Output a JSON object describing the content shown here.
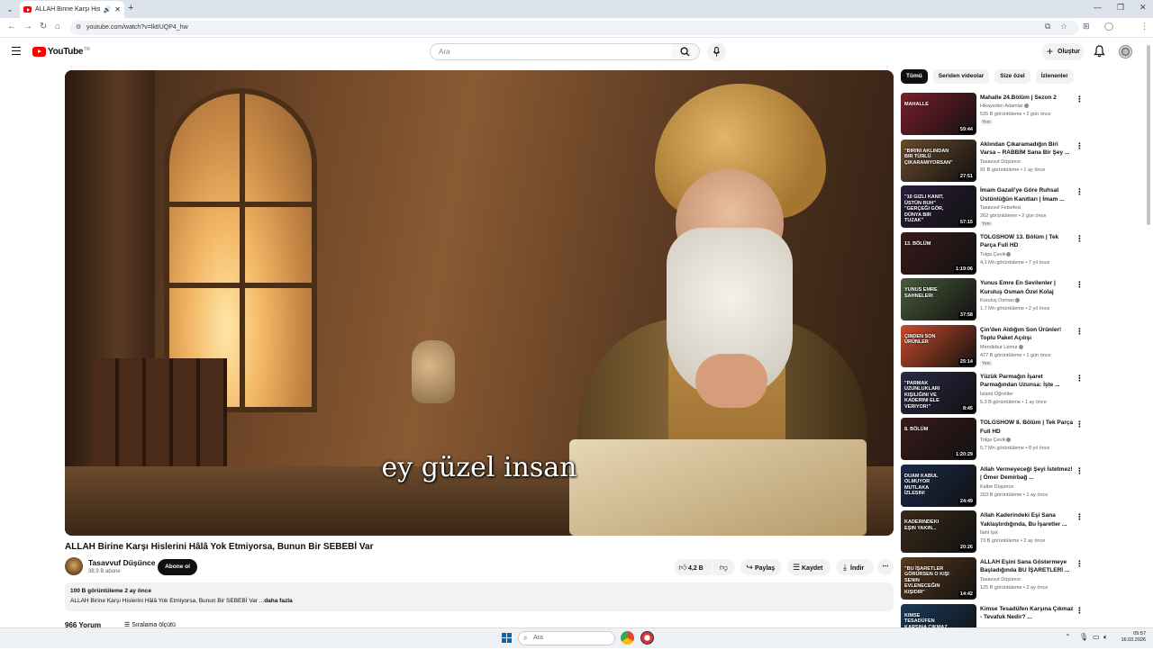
{
  "browser": {
    "tab_title": "ALLAH Birine Karşı Hislerin",
    "url": "youtube.com/watch?v=lktIUQP4_hw"
  },
  "masthead": {
    "logo_text": "YouTube",
    "logo_country": "TR",
    "search_placeholder": "Ara",
    "create_label": "Oluştur"
  },
  "player": {
    "subtitle": "ey güzel insan"
  },
  "video": {
    "title": "ALLAH Birine Karşı Hislerini Hâlâ Yok Etmiyorsa, Bunun Bir SEBEBİ Var",
    "channel_name": "Tasavvuf Düşünce",
    "subscribers": "38,9 B abone",
    "subscribe_label": "Abone ol",
    "likes": "4,2 B",
    "share_label": "Paylaş",
    "save_label": "Kaydet",
    "download_label": "İndir",
    "views_date": "100 B görüntüleme  2 ay önce",
    "description": "ALLAH Birine Karşı Hislerini Hâlâ Yok Etmiyorsa, Bunun Bir SEBEBİ Var ...",
    "more_label": "daha fazla",
    "comments_label": "966 Yorum",
    "sort_label": "Sıralama ölçütü"
  },
  "chips": [
    "Tümü",
    "Seriden videolar",
    "Size özel",
    "İzlenenler"
  ],
  "recommendations": [
    {
      "title": "Mahalle 24.Bölüm | Sezon 2",
      "channel": "Hikayeden Adamlar",
      "verified": true,
      "meta": "535 B görüntüleme • 2 gün önce",
      "badge": "Yeni",
      "duration": "59:44",
      "caption": "Mahalle",
      "color": "#7a1f2b"
    },
    {
      "title": "Aklından Çıkaramadığın Biri Varsa – RABBİM Sana Bir Şey ...",
      "channel": "Tasavvuf Düşünce",
      "verified": false,
      "meta": "91 B görüntüleme • 1 ay önce",
      "badge": "",
      "duration": "27:51",
      "caption": "\"Birini Aklından Bir Türlü Çıkaramıyorsan\"",
      "color": "#6b4a2a"
    },
    {
      "title": "İmam Gazali'ye Göre Ruhsal Üstünlüğün Kanıtları | İmam ...",
      "channel": "Tasavvuf Felsefesi",
      "verified": false,
      "meta": "262 görüntüleme • 2 gün önce",
      "badge": "Yeni",
      "duration": "57:15",
      "caption": "\"10 Gizli Kanıt, Üstün Ruh\" \"Gerçeği Gör, Dünya Bir Tuzak\"",
      "color": "#2a1e3a"
    },
    {
      "title": "TOLGSHOW 13. Bölüm | Tek Parça Full HD",
      "channel": "Tolga Çevik",
      "verified": true,
      "meta": "4,1 Mn görüntüleme • 7 yıl önce",
      "badge": "",
      "duration": "1:19:06",
      "caption": "13. Bölüm",
      "color": "#3a1a1a"
    },
    {
      "title": "Yunus Emre En Sevilenler | Kuruluş Osman Özel Kolaj",
      "channel": "Kuruluş Osman",
      "verified": true,
      "meta": "1,7 Mn görüntüleme • 2 yıl önce",
      "badge": "",
      "duration": "37:58",
      "caption": "Yunus Emre Sahneleri",
      "color": "#4a5a3a"
    },
    {
      "title": "Çin'den Aldığım Son Ürünler! Toplu Paket Açılışı",
      "channel": "Mendebur Lemur",
      "verified": true,
      "meta": "477 B görüntüleme • 1 gün önce",
      "badge": "Yeni",
      "duration": "25:14",
      "caption": "Çinden Son Ürünler",
      "color": "#c94a2a"
    },
    {
      "title": "Yüzük Parmağın İşaret Parmağından Uzunsa: İşte ...",
      "channel": "İslami Öğretiler",
      "verified": false,
      "meta": "5,3 B görüntüleme • 1 ay önce",
      "badge": "",
      "duration": "8:45",
      "caption": "\"Parmak Uzunlukları Kişiliğini ve Kaderini Ele Veriyor!\"",
      "color": "#2a2a4a"
    },
    {
      "title": "TOLGSHOW 8. Bölüm | Tek Parça Full HD",
      "channel": "Tolga Çevik",
      "verified": true,
      "meta": "5,7 Mn görüntüleme • 8 yıl önce",
      "badge": "",
      "duration": "1:20:29",
      "caption": "8. Bölüm",
      "color": "#3a1a1a"
    },
    {
      "title": "Allah Vermeyeceği Şeyi İstetmez! | Ömer Demirbağ ...",
      "channel": "Kalbe Düşünce",
      "verified": false,
      "meta": "203 B görüntüleme • 1 ay önce",
      "badge": "",
      "duration": "24:49",
      "caption": "Duam Kabul Olmuyor Mutlaka İzlesin!",
      "color": "#1a2a4a"
    },
    {
      "title": "Allah Kaderindeki Eşi Sana Yaklaştırdığında, Bu İşaretler ...",
      "channel": "İlahi Işık",
      "verified": false,
      "meta": "73 B görüntüleme • 2 ay önce",
      "badge": "",
      "duration": "20:26",
      "caption": "Kaderindeki Eşin Yakın...",
      "color": "#3a2a1a"
    },
    {
      "title": "ALLAH Eşini Sana Göstermeye Başladığında BU İŞARETLERİ ...",
      "channel": "Tasavvuf Düşünce",
      "verified": false,
      "meta": "125 B görüntüleme • 2 ay önce",
      "badge": "",
      "duration": "14:42",
      "caption": "\"Bu İşaretler Görürsen O Kişi Senin Evleneceğin Kişidir\"",
      "color": "#5a3a1a"
    },
    {
      "title": "Kimse Tesadüfen Karşına Çıkmaz - Tevafuk Nedir? ...",
      "channel": "",
      "verified": false,
      "meta": "",
      "badge": "",
      "duration": "",
      "caption": "Kimse Tesadüfen Karşına Çıkmaz",
      "color": "#1a3a5a"
    }
  ],
  "taskbar": {
    "search_placeholder": "Ara",
    "time": "05:57",
    "date": "16.03.2026"
  }
}
